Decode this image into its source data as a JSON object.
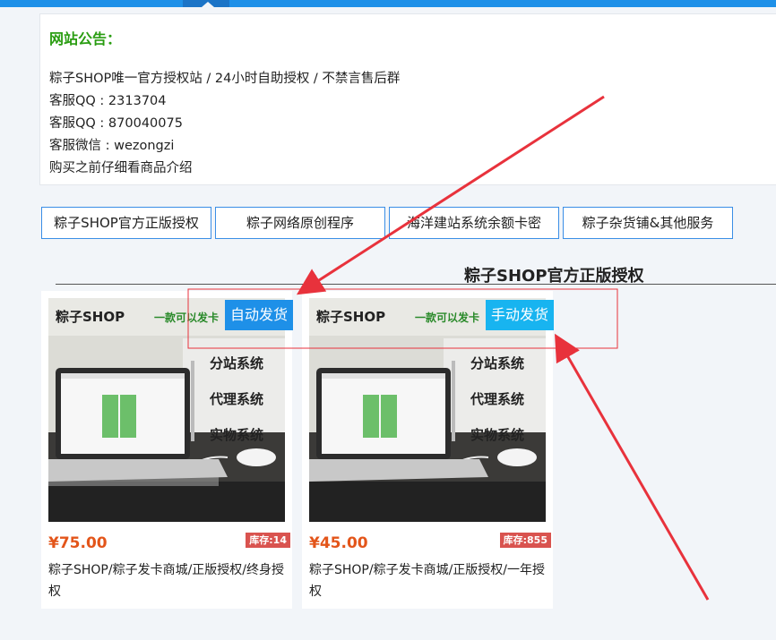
{
  "notice": {
    "title": "网站公告：",
    "lines": [
      "粽子SHOP唯一官方授权站 / 24小时自助授权 / 不禁言售后群",
      "客服QQ : 2313704",
      "客服QQ : 870040075",
      "客服微信 : wezongzi",
      "购买之前仔细看商品介绍"
    ]
  },
  "tabs": [
    "粽子SHOP官方正版授权",
    "粽子网络原创程序",
    "海洋建站系统余额卡密",
    "粽子杂货铺&其他服务"
  ],
  "section": {
    "title": "粽子SHOP官方正版授权"
  },
  "products": [
    {
      "badge": "自动发货",
      "badge_color": "#1e90e8",
      "price": "¥75.00",
      "stock": "库存:14",
      "name": "粽子SHOP/粽子发卡商城/正版授权/终身授权",
      "image": {
        "banner_left": "粽子SHOP",
        "banner_right": "一款可以发卡",
        "features": [
          "分站系统",
          "代理系统",
          "实物系统"
        ]
      }
    },
    {
      "badge": "手动发货",
      "badge_color": "#18b4f0",
      "price": "¥45.00",
      "stock": "库存:855",
      "name": "粽子SHOP/粽子发卡商城/正版授权/一年授权",
      "image": {
        "banner_left": "粽子SHOP",
        "banner_right": "一款可以发卡",
        "features": [
          "分站系统",
          "代理系统",
          "实物系统"
        ]
      }
    }
  ],
  "colors": {
    "accent": "#1e90e8",
    "notice_title": "#2a9d12",
    "price": "#e3551a",
    "stock_badge": "#d9534f",
    "annotation": "#e8323c"
  }
}
